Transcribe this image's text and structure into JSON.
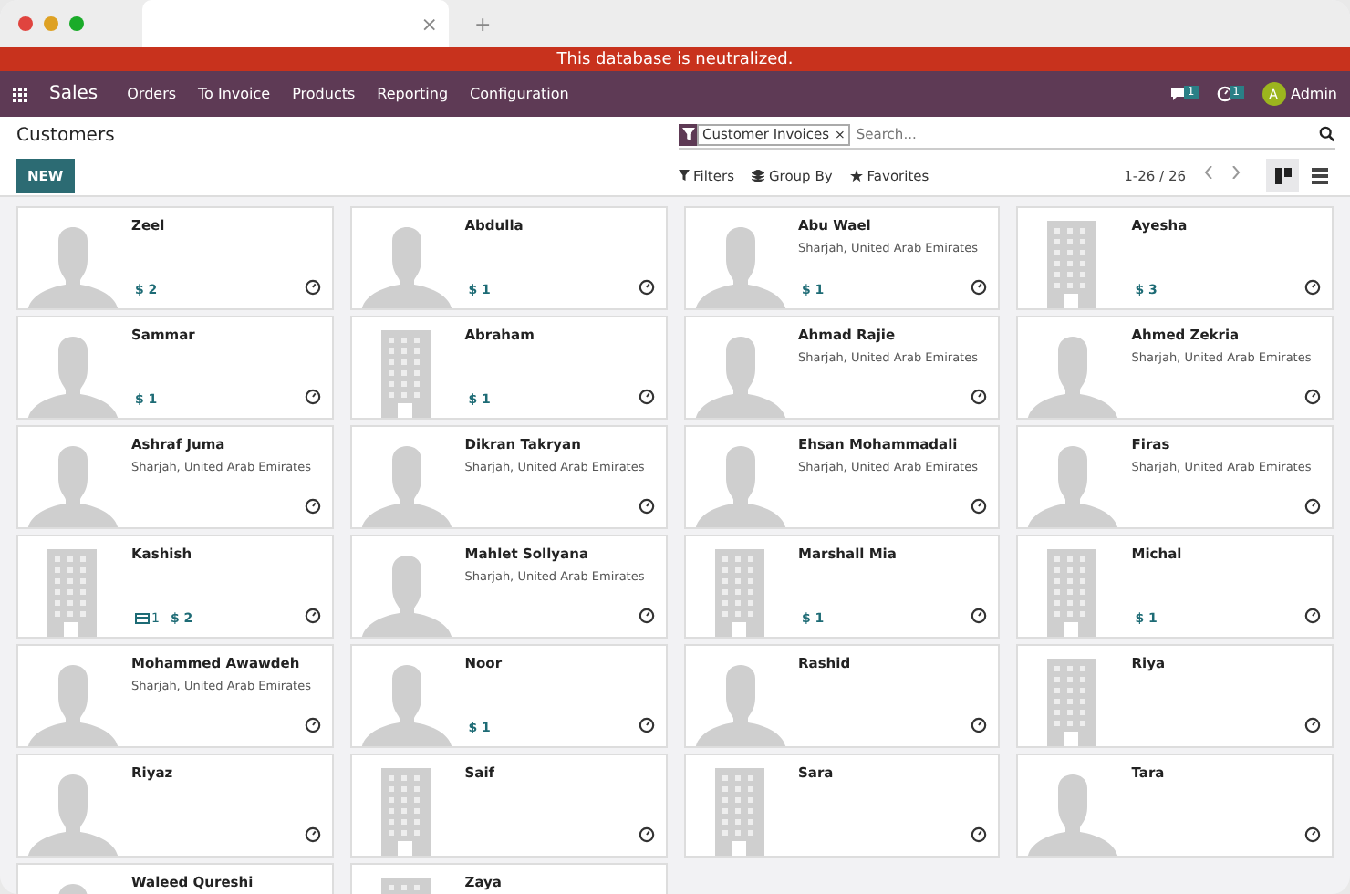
{
  "browser": {
    "tab_close": "×",
    "new_tab": "+"
  },
  "banner": {
    "text": "This database is neutralized."
  },
  "navbar": {
    "app": "Sales",
    "menus": [
      "Orders",
      "To Invoice",
      "Products",
      "Reporting",
      "Configuration"
    ],
    "messages_count": "1",
    "activities_count": "1",
    "user_initial": "A",
    "user_name": "Admin"
  },
  "control_panel": {
    "title": "Customers",
    "new_button": "NEW",
    "facet": "Customer Invoices",
    "facet_remove": "×",
    "search_placeholder": "Search...",
    "filters": "Filters",
    "group_by": "Group By",
    "favorites": "Favorites",
    "pager": "1-26 / 26",
    "views": [
      {
        "kind": "kanban",
        "selected": true
      },
      {
        "kind": "list",
        "selected": false
      }
    ]
  },
  "cards": [
    {
      "name": "Zeel",
      "kind": "person",
      "invoices": "$ 2"
    },
    {
      "name": "Abdulla",
      "kind": "person",
      "invoices": "$ 1"
    },
    {
      "name": "Abu Wael",
      "kind": "person",
      "address": "Sharjah, United Arab Emirates",
      "invoices": "$ 1"
    },
    {
      "name": "Ayesha",
      "kind": "company",
      "invoices": "$ 3"
    },
    {
      "name": "Sammar",
      "kind": "person",
      "invoices": "$ 1"
    },
    {
      "name": "Abraham",
      "kind": "company",
      "invoices": "$ 1"
    },
    {
      "name": "Ahmad Rajie",
      "kind": "person",
      "address": "Sharjah, United Arab Emirates"
    },
    {
      "name": "Ahmed Zekria",
      "kind": "person",
      "address": "Sharjah, United Arab Emirates"
    },
    {
      "name": "Ashraf Juma",
      "kind": "person",
      "address": "Sharjah, United Arab Emirates"
    },
    {
      "name": "Dikran Takryan",
      "kind": "person",
      "address": "Sharjah, United Arab Emirates"
    },
    {
      "name": "Ehsan Mohammadali",
      "kind": "person",
      "address": "Sharjah, United Arab Emirates"
    },
    {
      "name": "Firas",
      "kind": "person",
      "address": "Sharjah, United Arab Emirates"
    },
    {
      "name": "Kashish",
      "kind": "company",
      "bank_accounts": "1",
      "invoices": "$ 2"
    },
    {
      "name": "Mahlet Sollyana",
      "kind": "person",
      "address": "Sharjah, United Arab Emirates"
    },
    {
      "name": "Marshall Mia",
      "kind": "company",
      "invoices": "$ 1"
    },
    {
      "name": "Michal",
      "kind": "company",
      "invoices": "$ 1"
    },
    {
      "name": "Mohammed Awawdeh",
      "kind": "person",
      "address": "Sharjah, United Arab Emirates"
    },
    {
      "name": "Noor",
      "kind": "person",
      "invoices": "$ 1"
    },
    {
      "name": "Rashid",
      "kind": "person"
    },
    {
      "name": "Riya",
      "kind": "company"
    },
    {
      "name": "Riyaz",
      "kind": "person"
    },
    {
      "name": "Saif",
      "kind": "company"
    },
    {
      "name": "Sara",
      "kind": "company"
    },
    {
      "name": "Tara",
      "kind": "person"
    },
    {
      "name": "Waleed Qureshi",
      "kind": "person"
    },
    {
      "name": "Zaya",
      "kind": "company"
    }
  ]
}
